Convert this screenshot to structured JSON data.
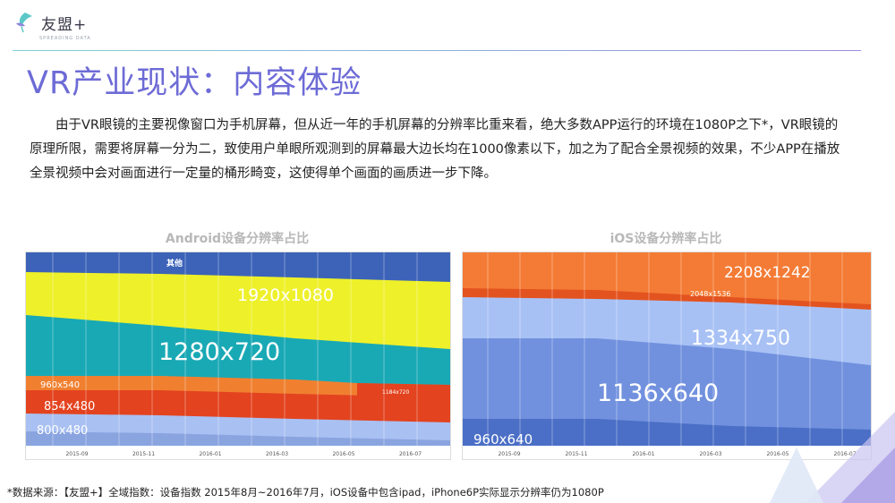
{
  "header": {
    "logo_text": "友盟+",
    "logo_sub": "SPREADING DATA"
  },
  "title": "VR产业现状：内容体验",
  "paragraph": "由于VR眼镜的主要视像窗口为手机屏幕，但从近一年的手机屏幕的分辨率比重来看，绝大多数APP运行的环境在1080P之下*，VR眼镜的原理所限，需要将屏幕一分为二，致使用户单眼所观测到的屏幕最大边长均在1000像素以下，加之为了配合全景视频的效果，不少APP在播放全景视频中会对画面进行一定量的桶形畸变，这使得单个画面的画质进一步下降。",
  "footnote": "*数据来源：【友盟+】全域指数：设备指数 2015年8月~2016年7月，iOS设备中包含ipad，iPhone6P实际显示分辨率仍为1080P",
  "chart_data": [
    {
      "type": "area",
      "title": "Android设备分辨率占比",
      "x": [
        "2015-09",
        "2015-11",
        "2016-01",
        "2016-03",
        "2016-05",
        "2016-07"
      ],
      "series": [
        {
          "name": "800x480",
          "color": "#a9c0f2"
        },
        {
          "name": "854x480",
          "color": "#e3431f"
        },
        {
          "name": "960x540",
          "color": "#f08030"
        },
        {
          "name": "1184x720",
          "color": "#e3431f"
        },
        {
          "name": "1280x720",
          "color": "#19a9b5"
        },
        {
          "name": "1920x1080",
          "color": "#eef02a"
        },
        {
          "name": "其他",
          "color": "#3c63b8"
        }
      ]
    },
    {
      "type": "area",
      "title": "iOS设备分辨率占比",
      "x": [
        "2015-09",
        "2015-11",
        "2016-01",
        "2016-03",
        "2016-05",
        "2016-07"
      ],
      "series": [
        {
          "name": "960x640",
          "color": "#4b6fc6"
        },
        {
          "name": "1136x640",
          "color": "#7191de"
        },
        {
          "name": "1334x750",
          "color": "#a8c1f5"
        },
        {
          "name": "2048x1536",
          "color": "#e3531f"
        },
        {
          "name": "2208x1242",
          "color": "#f47b35"
        }
      ]
    }
  ]
}
